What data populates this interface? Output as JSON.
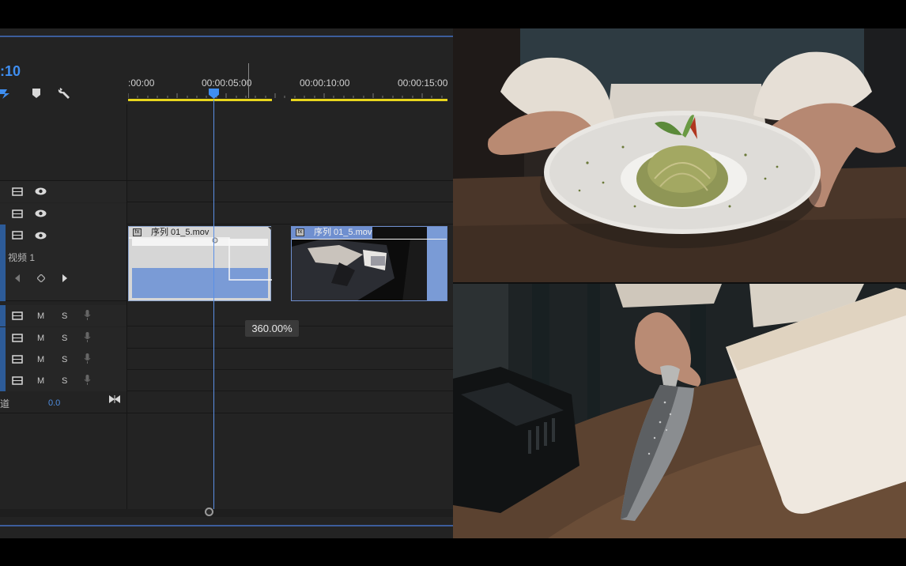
{
  "timeline": {
    "timecode": ":10",
    "ruler_labels": [
      ":00:00",
      "00:00:05:00",
      "00:00:10:00",
      "00:00:15:00"
    ],
    "tracks": {
      "video_track_label": "视频 1",
      "audio_mute_label": "M",
      "audio_solo_label": "S",
      "channel_label": "道",
      "channel_value": "0.0"
    },
    "clips": [
      {
        "name": "序列 01_5.mov"
      },
      {
        "name": "序列 01_5.mov"
      }
    ],
    "speed_badge": "360.00%"
  },
  "icons": {
    "snap": "snap-icon",
    "marker": "marker-icon",
    "wrench": "wrench-icon",
    "toggle_output": "film-strip-icon",
    "eye": "eye-icon",
    "mic": "microphone-icon",
    "keyframe": "keyframe-icon"
  },
  "colors": {
    "accent": "#3f8ef0",
    "work_area": "#e8d51d",
    "clip_blue": "#7a9bd6",
    "panel_bg": "#232323"
  }
}
